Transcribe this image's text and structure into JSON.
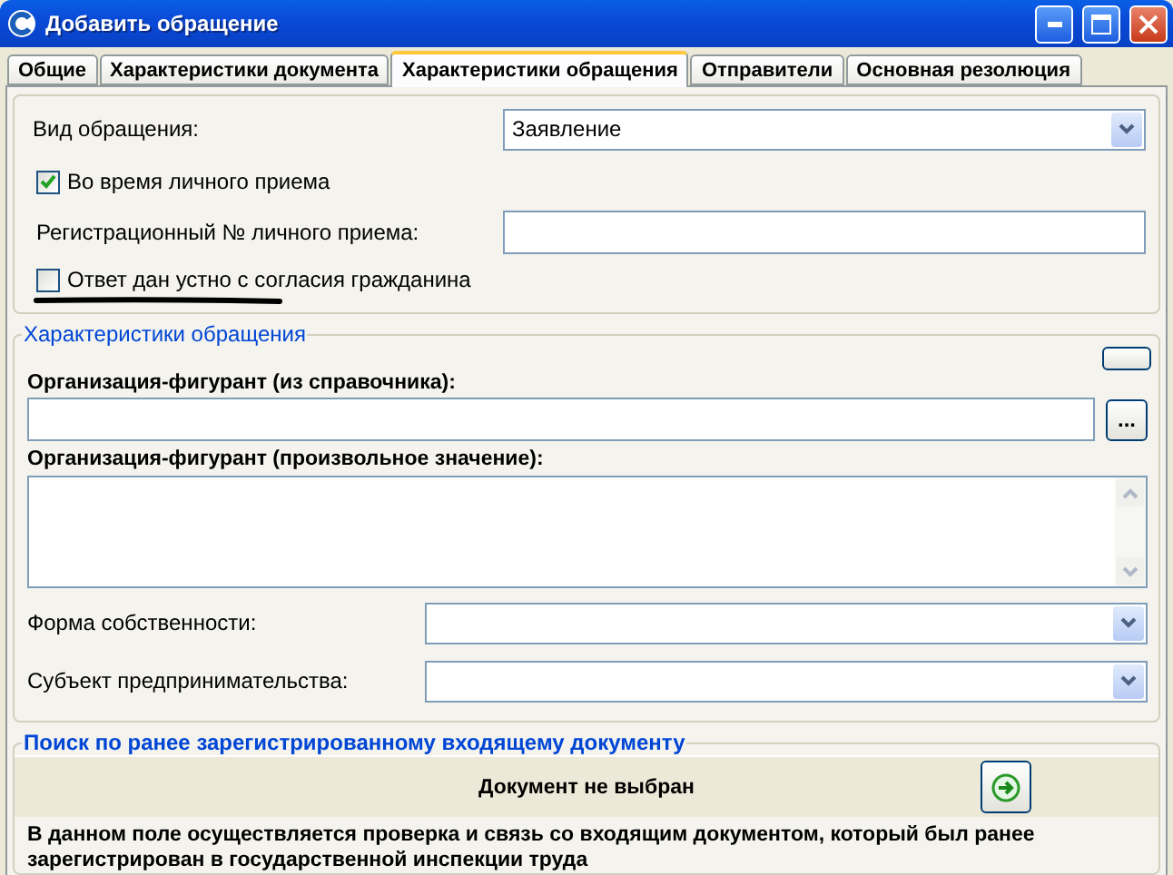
{
  "window": {
    "title": "Добавить обращение"
  },
  "tabs": [
    {
      "label": "Общие",
      "selected": false
    },
    {
      "label": "Характеристики документа",
      "selected": false
    },
    {
      "label": "Характеристики обращения",
      "selected": true
    },
    {
      "label": "Отправители",
      "selected": false
    },
    {
      "label": "Основная резолюция",
      "selected": false
    }
  ],
  "request_section": {
    "rows": [
      {
        "kind": "select",
        "label": "Вид обращения:",
        "value": "Заявление"
      },
      {
        "kind": "checkbox",
        "label": "Во время личного приема",
        "checked": true
      },
      {
        "kind": "text",
        "label": "Регистрационный № личного приема:"
      },
      {
        "kind": "checkbox",
        "label": "Ответ дан устно с согласия гражданина",
        "checked": false,
        "underlined": true
      }
    ]
  },
  "characteristics_group": {
    "title": "Характеристики обращения",
    "org_lookup_label": "Организация-фигурант (из справочника):",
    "browse_button": "...",
    "org_free_label": "Организация-фигурант (произвольное значение):",
    "selects": [
      {
        "label": "Форма собственности:"
      },
      {
        "label": "Субъект предпринимательства:"
      }
    ]
  },
  "search_group": {
    "title": "Поиск по ранее зарегистрированному входящему документу",
    "status": "Документ не выбран",
    "note": "В данном поле осуществляется проверка и связь со входящим документом, который был ранее зарегистрирован в государственной инспекции труда"
  }
}
